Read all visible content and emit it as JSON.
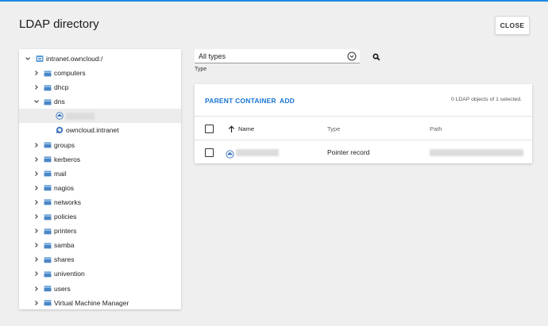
{
  "dialog": {
    "title": "LDAP directory",
    "close_label": "CLOSE"
  },
  "tree": {
    "root": "intranet.owncloud:/",
    "items": [
      {
        "label": "computers",
        "expanded": false,
        "depth": 1
      },
      {
        "label": "dhcp",
        "expanded": false,
        "depth": 1
      },
      {
        "label": "dns",
        "expanded": true,
        "depth": 1
      },
      {
        "label": "",
        "expanded": false,
        "depth": 2,
        "selected": true,
        "redacted": true,
        "icon": "dns-record-icon"
      },
      {
        "label": "owncloud.intranet",
        "expanded": false,
        "depth": 2,
        "icon": "dns-zone-icon"
      },
      {
        "label": "groups",
        "expanded": false,
        "depth": 1
      },
      {
        "label": "kerberos",
        "expanded": false,
        "depth": 1
      },
      {
        "label": "mail",
        "expanded": false,
        "depth": 1
      },
      {
        "label": "nagios",
        "expanded": false,
        "depth": 1
      },
      {
        "label": "networks",
        "expanded": false,
        "depth": 1
      },
      {
        "label": "policies",
        "expanded": false,
        "depth": 1
      },
      {
        "label": "printers",
        "expanded": false,
        "depth": 1
      },
      {
        "label": "samba",
        "expanded": false,
        "depth": 1
      },
      {
        "label": "shares",
        "expanded": false,
        "depth": 1
      },
      {
        "label": "univention",
        "expanded": false,
        "depth": 1
      },
      {
        "label": "users",
        "expanded": false,
        "depth": 1
      },
      {
        "label": "Virtual Machine Manager",
        "expanded": false,
        "depth": 1
      }
    ]
  },
  "filter": {
    "type_value": "All types",
    "type_label": "Type"
  },
  "toolbar": {
    "parent_container_label": "PARENT CONTAINER",
    "add_label": "ADD",
    "selection_count": "0 LDAP objects of 1 selected."
  },
  "table": {
    "columns": [
      "Name",
      "Type",
      "Path"
    ],
    "rows": [
      {
        "name": "",
        "type": "Pointer record",
        "path": "",
        "redacted": true
      }
    ]
  },
  "colors": {
    "accent": "#1976d2",
    "folder_icon": "#5b9bd5",
    "background": "#efefef"
  }
}
